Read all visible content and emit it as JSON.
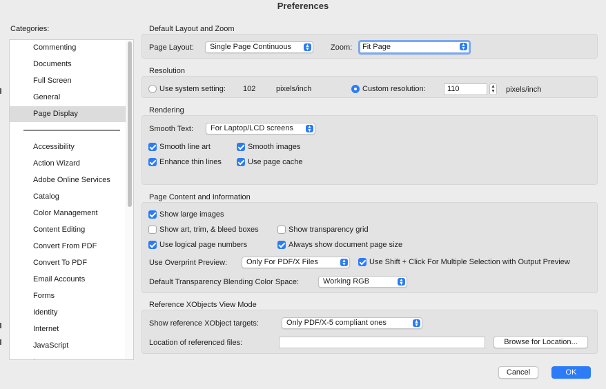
{
  "window": {
    "title": "Preferences"
  },
  "sidebar": {
    "label": "Categories:",
    "items": [
      "Commenting",
      "Documents",
      "Full Screen",
      "General",
      "Page Display",
      "Accessibility",
      "Action Wizard",
      "Adobe Online Services",
      "Catalog",
      "Color Management",
      "Content Editing",
      "Convert From PDF",
      "Convert To PDF",
      "Email Accounts",
      "Forms",
      "Identity",
      "Internet",
      "JavaScript",
      "L..."
    ],
    "selected": "Page Display"
  },
  "layout_zoom": {
    "title": "Default Layout and Zoom",
    "page_layout_label": "Page Layout:",
    "page_layout_value": "Single Page Continuous",
    "zoom_label": "Zoom:",
    "zoom_value": "Fit Page"
  },
  "resolution": {
    "title": "Resolution",
    "system_label": "Use system setting:",
    "system_value": "102",
    "system_unit": "pixels/inch",
    "custom_label": "Custom resolution:",
    "custom_value": "110",
    "custom_unit": "pixels/inch"
  },
  "rendering": {
    "title": "Rendering",
    "smooth_text_label": "Smooth Text:",
    "smooth_text_value": "For Laptop/LCD screens",
    "smooth_line_art": "Smooth line art",
    "smooth_images": "Smooth images",
    "enhance_thin_lines": "Enhance thin lines",
    "use_page_cache": "Use page cache"
  },
  "content_info": {
    "title": "Page Content and Information",
    "show_large_images": "Show large images",
    "show_art_trim": "Show art, trim, & bleed boxes",
    "show_transparency_grid": "Show transparency grid",
    "use_logical_page_numbers": "Use logical page numbers",
    "always_show_doc_size": "Always show document page size",
    "overprint_label": "Use Overprint Preview:",
    "overprint_value": "Only For PDF/X Files",
    "shift_click": "Use Shift + Click For Multiple Selection with Output Preview",
    "blending_label": "Default Transparency Blending Color Space:",
    "blending_value": "Working RGB"
  },
  "xobjects": {
    "title": "Reference XObjects View Mode",
    "targets_label": "Show reference XObject targets:",
    "targets_value": "Only PDF/X-5 compliant ones",
    "location_label": "Location of referenced files:",
    "location_value": "",
    "browse_button": "Browse for Location..."
  },
  "footer": {
    "cancel": "Cancel",
    "ok": "OK"
  },
  "colors": {
    "accent": "#2b7cf6"
  }
}
